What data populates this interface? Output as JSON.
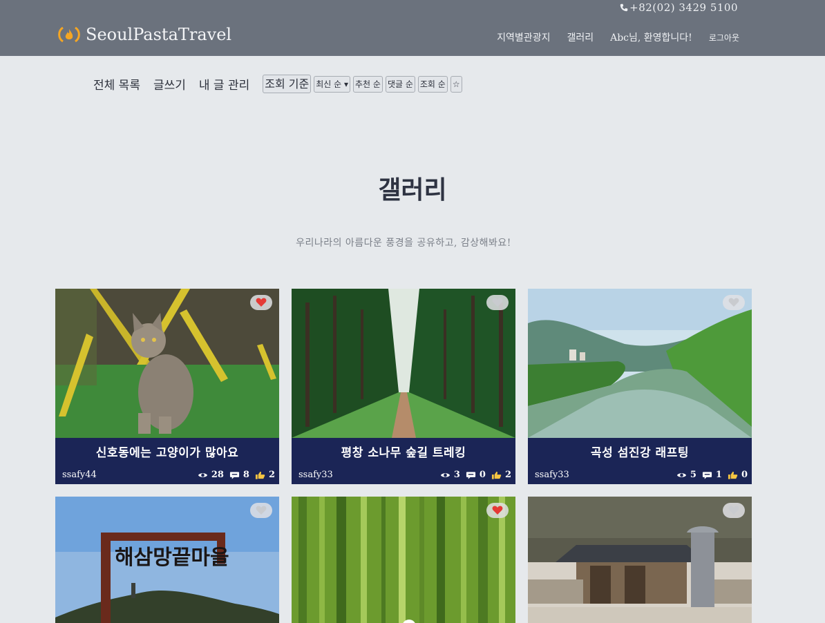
{
  "header": {
    "phone": "+82(02) 3429 5100",
    "brand": "SeoulPastaTravel",
    "nav": [
      "지역별관광지",
      "갤러리",
      "Abc님, 환영합니다!",
      "로그아웃"
    ]
  },
  "subnav": {
    "links": [
      "전체 목록",
      "글쓰기",
      "내 글 관리"
    ],
    "sort_label": "조회 기준",
    "sort_select": "최신 순 ▾",
    "sort_buttons": [
      "추천 순",
      "댓글 순",
      "조회 순"
    ],
    "star": "☆"
  },
  "hero": {
    "title": "갤러리",
    "subtitle": "우리나라의 아름다운 풍경을 공유하고, 감상해봐요!"
  },
  "cards": [
    {
      "title": "신호동에는 고양이가 많아요",
      "user": "ssafy44",
      "views": "28",
      "comments": "8",
      "likes": "2",
      "liked": true,
      "image": "cat-on-grass-photo"
    },
    {
      "title": "평창 소나무 숲길 트레킹",
      "user": "ssafy33",
      "views": "3",
      "comments": "0",
      "likes": "2",
      "liked": false,
      "image": "pine-forest-path-photo"
    },
    {
      "title": "곡성 섬진강 래프팅",
      "user": "ssafy33",
      "views": "5",
      "comments": "1",
      "likes": "0",
      "liked": false,
      "image": "river-valley-photo"
    },
    {
      "liked": false,
      "image": "village-sign-sky-photo",
      "sign_text": "해삼망끝마을"
    },
    {
      "liked": true,
      "image": "bamboo-forest-photo"
    },
    {
      "liked": false,
      "image": "traditional-house-photo"
    }
  ],
  "colors": {
    "topbar": "#6b727d",
    "background": "#e6e9ec",
    "card_footer": "#1b2556",
    "heart_active": "#e53935",
    "logo": "#f5a623"
  }
}
